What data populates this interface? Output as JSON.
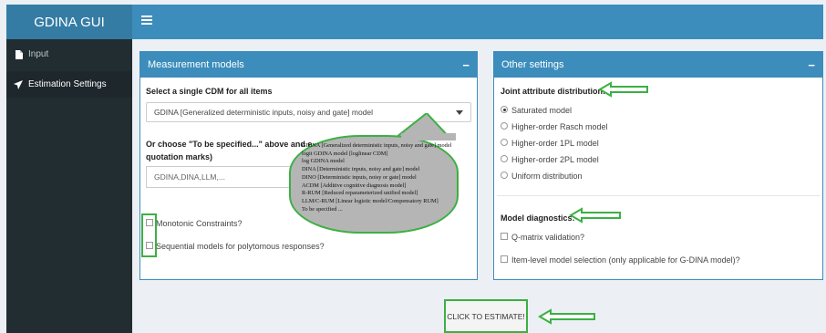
{
  "app": {
    "title": "GDINA GUI"
  },
  "sidebar": {
    "items": [
      {
        "label": "Input",
        "icon": "file-icon",
        "active": false
      },
      {
        "label": "Estimation Settings",
        "icon": "paper-plane-icon",
        "active": true
      }
    ]
  },
  "measurement": {
    "title": "Measurement models",
    "minimize": "−",
    "select_label": "Select a single CDM for all items",
    "select_value": "GDINA [Generalized deterministic inputs, noisy and gate] model",
    "choose_label_line1": "Or choose \"To be specified...\" above and e",
    "choose_label_line2": "quotation marks)",
    "input_placeholder": "GDINA,DINA,LLM,...",
    "options": [
      "GDINA [Generalized deterministic inputs, noisy and gate] model",
      "logit GDINA model [loglinear CDM]",
      "log GDINA model",
      "DINA [Deterministic inputs, noisy and gate] model",
      "DINO [Deterministic inputs, noisy or gate] model",
      "ACDM [Additive cognitive diagnosis model]",
      "R-RUM [Reduced reparameterized unified model]",
      "LLM/C-RUM [Linear logistic model/Compensatory RUM]",
      "To be specified ..."
    ],
    "monotonic_label": "Monotonic Constraints?",
    "sequential_label": "Sequential models for polytomous responses?"
  },
  "other": {
    "title": "Other settings",
    "minimize": "−",
    "joint_label": "Joint attribute distribution:",
    "joint_options": [
      {
        "label": "Saturated model",
        "selected": true
      },
      {
        "label": "Higher-order Rasch model",
        "selected": false
      },
      {
        "label": "Higher-order 1PL model",
        "selected": false
      },
      {
        "label": "Higher-order 2PL model",
        "selected": false
      },
      {
        "label": "Uniform distribution",
        "selected": false
      }
    ],
    "diag_label": "Model diagnostics:",
    "qmatrix_label": "Q-matrix validation?",
    "itemlevel_label": "Item-level model selection (only applicable for G-DINA model)?"
  },
  "estimate_button": "CLICK TO ESTIMATE!",
  "colors": {
    "primary": "#3c8dbc",
    "sidebar": "#222d32",
    "annotation": "#3cb043",
    "tooltip": "#b5b5b5"
  }
}
